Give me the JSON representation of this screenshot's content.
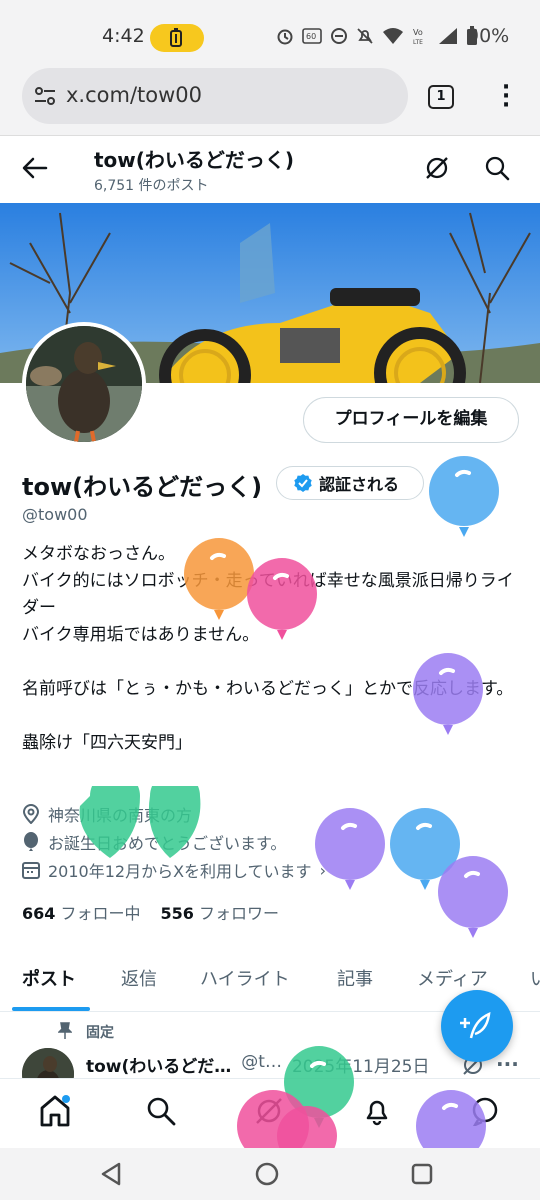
{
  "status_bar": {
    "time": "4:42",
    "battery_pct": "90%",
    "icons": [
      "alarm-icon",
      "60hz-icon",
      "dnd-icon",
      "mute-icon",
      "wifi-icon",
      "volte-icon",
      "signal-icon",
      "battery-icon"
    ],
    "accent": "#f7c81e"
  },
  "browser": {
    "url": "x.com/tow00",
    "tab_count": "1"
  },
  "header": {
    "title": "tow(わいるどだっく)",
    "post_count": "6,751 件のポスト"
  },
  "profile": {
    "edit_button": "プロフィールを編集",
    "name": "tow(わいるどだっく)",
    "verified_label": "認証される",
    "handle": "@tow00",
    "bio": "メタボなおっさん。\nバイク的にはソロボッチ・走っていれば幸せな風景派日帰りライダー\nバイク専用垢ではありません。\n\n名前呼びは「とぅ・かも・わいるどだっく」とかで反応します。\n\n蟲除け「四六天安門」",
    "location": "神奈川県の南東の方",
    "birthday": "お誕生日おめでとうございます。",
    "joined": "2010年12月からXを利用しています",
    "following_count": "664",
    "following_label": "フォロー中",
    "followers_count": "556",
    "followers_label": "フォロワー"
  },
  "tabs": [
    "ポスト",
    "返信",
    "ハイライト",
    "記事",
    "メディア",
    "い"
  ],
  "pinned_post": {
    "pinned_label": "固定",
    "author": "tow(わいるどだ…",
    "handle": "@t…",
    "date": "2025年11月25日"
  },
  "colors": {
    "brand_blue": "#1d9bf0",
    "text": "#0f1419",
    "muted": "#536471",
    "balloon_blue": "#4aa8f0",
    "balloon_green": "#34c98e",
    "balloon_pink": "#f0509c",
    "balloon_purple": "#9b7cf2",
    "balloon_orange": "#f7963a"
  }
}
